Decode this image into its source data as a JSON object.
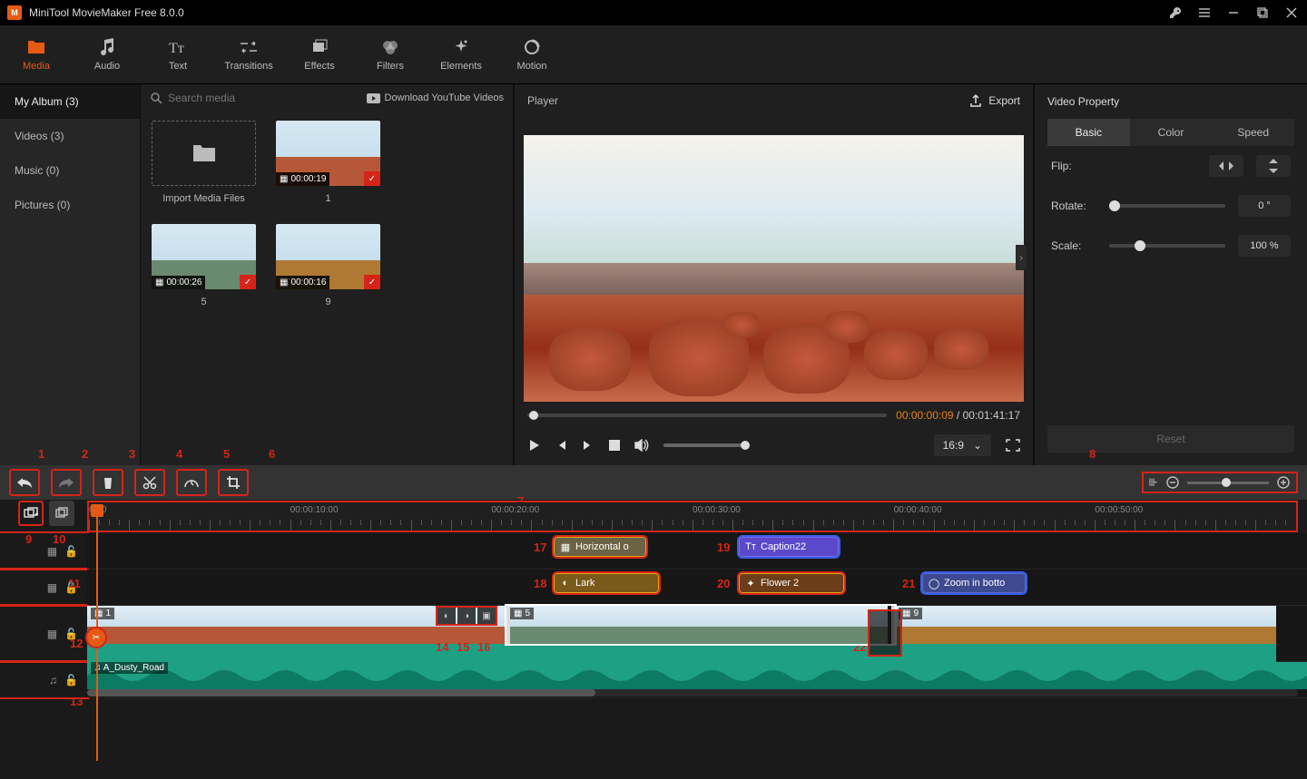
{
  "titlebar": {
    "title": "MiniTool MovieMaker Free 8.0.0"
  },
  "toptabs": [
    {
      "id": "media",
      "label": "Media",
      "active": true,
      "icon": "folder"
    },
    {
      "id": "audio",
      "label": "Audio",
      "icon": "music"
    },
    {
      "id": "text",
      "label": "Text",
      "icon": "text"
    },
    {
      "id": "transitions",
      "label": "Transitions",
      "icon": "transition"
    },
    {
      "id": "effects",
      "label": "Effects",
      "icon": "effects"
    },
    {
      "id": "filters",
      "label": "Filters",
      "icon": "filters"
    },
    {
      "id": "elements",
      "label": "Elements",
      "icon": "sparkle"
    },
    {
      "id": "motion",
      "label": "Motion",
      "icon": "motion"
    }
  ],
  "sidebar": {
    "items": [
      {
        "label": "My Album (3)",
        "active": true
      },
      {
        "label": "Videos (3)"
      },
      {
        "label": "Music (0)"
      },
      {
        "label": "Pictures (0)"
      }
    ]
  },
  "search": {
    "placeholder": "Search media"
  },
  "download_youtube": "Download YouTube Videos",
  "media": {
    "import_label": "Import Media Files",
    "clips": [
      {
        "duration": "00:00:19",
        "caption": "1",
        "land": "#b65838"
      },
      {
        "duration": "00:00:26",
        "caption": "5",
        "land": "#6a8a6f"
      },
      {
        "duration": "00:00:16",
        "caption": "9",
        "land": "#b07933"
      }
    ]
  },
  "player": {
    "title": "Player",
    "export": "Export",
    "current_time": "00:00:00:09",
    "total_time": "00:01:41:17",
    "aspect": "16:9"
  },
  "props": {
    "title": "Video Property",
    "tabs": [
      {
        "label": "Basic",
        "active": true
      },
      {
        "label": "Color"
      },
      {
        "label": "Speed"
      }
    ],
    "flip_label": "Flip:",
    "rotate_label": "Rotate:",
    "rotate_value": "0 °",
    "scale_label": "Scale:",
    "scale_value": "100 %",
    "reset": "Reset"
  },
  "ruler_labels": [
    "0:00",
    "00:00:10:00",
    "00:00:20:00",
    "00:00:30:00",
    "00:00:40:00",
    "00:00:50:00"
  ],
  "clips_row1": {
    "horizontal": "Horizontal o",
    "caption": "Caption22"
  },
  "clips_row2": {
    "lark": "Lark",
    "flower": "Flower 2",
    "zoom": "Zoom in botto"
  },
  "video_clips": [
    {
      "label": "1"
    },
    {
      "label": "5"
    },
    {
      "label": "9"
    }
  ],
  "music": {
    "label": "A_Dusty_Road"
  },
  "annotations": {
    "a1": "1",
    "a2": "2",
    "a3": "3",
    "a4": "4",
    "a5": "5",
    "a6": "6",
    "a7": "7",
    "a8": "8",
    "a9": "9",
    "a10": "10",
    "a11": "11",
    "a12": "12",
    "a13": "13",
    "a14": "14",
    "a15": "15",
    "a16": "16",
    "a17": "17",
    "a18": "18",
    "a19": "19",
    "a20": "20",
    "a21": "21",
    "a22": "22"
  }
}
